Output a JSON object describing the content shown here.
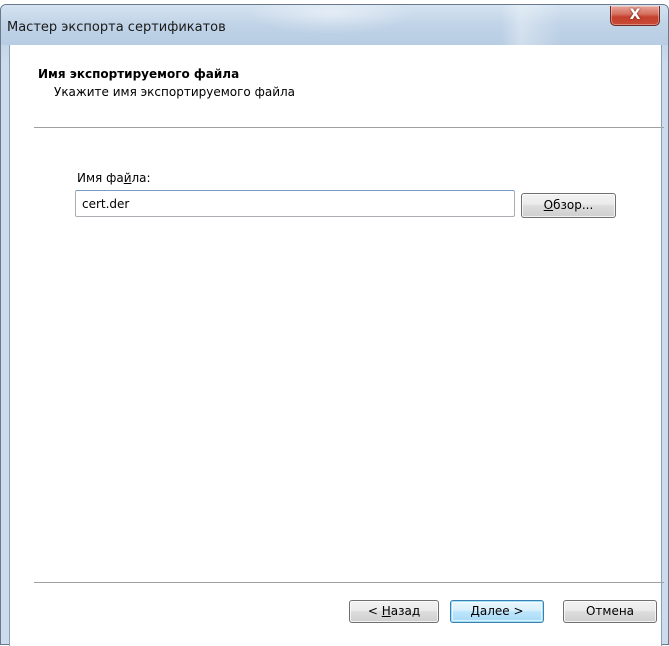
{
  "window": {
    "title": "Мастер экспорта сертификатов",
    "close_glyph": "X",
    "close_icon": "close-icon"
  },
  "header": {
    "title": "Имя экспортируемого файла",
    "subtitle": "Укажите имя экспортируемого файла"
  },
  "form": {
    "filename_label_before": "Имя фа",
    "filename_label_mnemonic": "й",
    "filename_label_after": "ла:",
    "filename_value": "cert.der",
    "browse_mnemonic": "О",
    "browse_rest": "бзор..."
  },
  "footer": {
    "back_prefix": "< ",
    "back_mnemonic": "Н",
    "back_rest": "азад",
    "next_mnemonic": "Д",
    "next_rest": "алее >",
    "cancel_label": "Отмена"
  },
  "colors": {
    "close_button": "#c84a35",
    "default_button_border": "#3c7fb1"
  }
}
